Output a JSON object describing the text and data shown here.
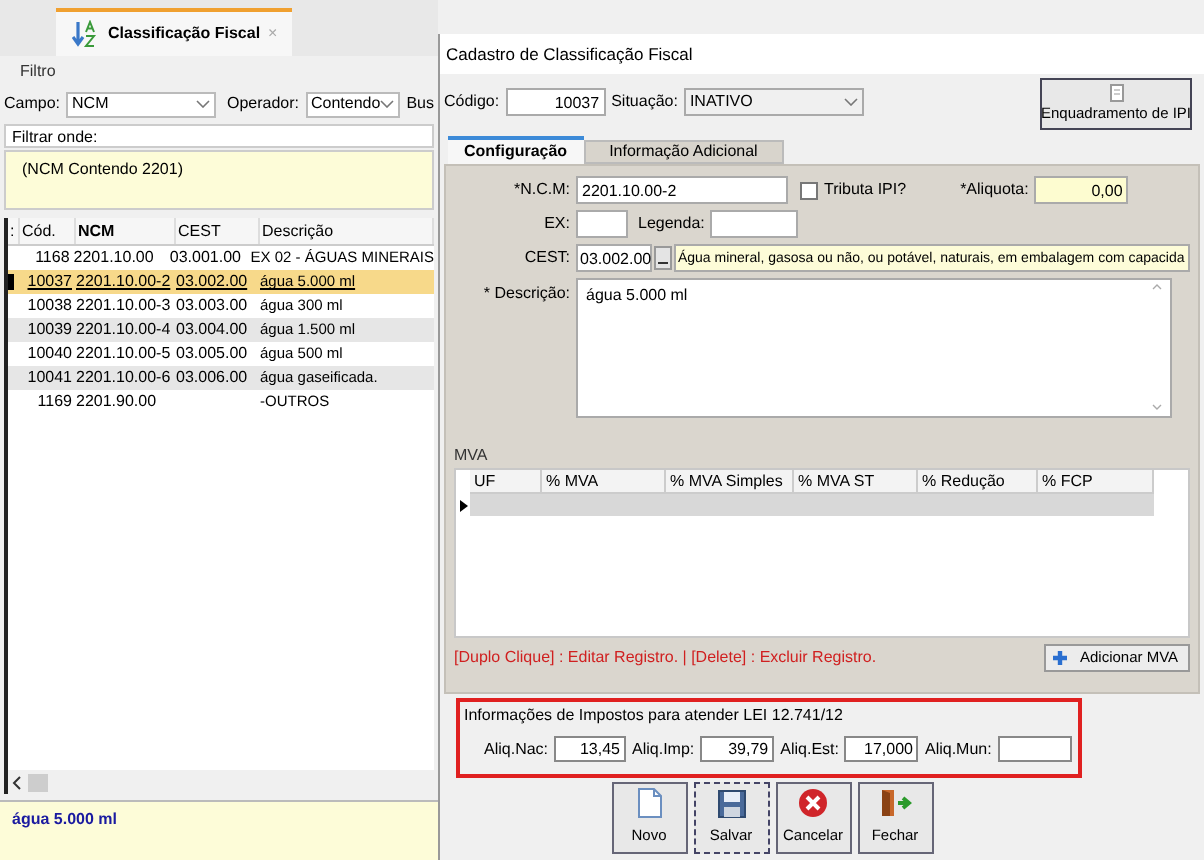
{
  "tab": {
    "title": "Classificação Fiscal",
    "close": "×"
  },
  "filter": {
    "title": "Filtro",
    "campo_label": "Campo:",
    "campo": "NCM",
    "operador_label": "Operador:",
    "operador": "Contendo",
    "busca_label": "Bus",
    "where_label": "Filtrar onde:",
    "expression": "(NCM Contendo 2201)"
  },
  "grid": {
    "columns": [
      ":",
      "Cód.",
      "NCM",
      "CEST",
      "Descrição"
    ],
    "rows": [
      {
        "cod": "1168",
        "ncm": "2201.10.00",
        "cest": "03.001.00",
        "descricao": "EX 02 - ÁGUAS MINERAIS",
        "selected": false
      },
      {
        "cod": "10037",
        "ncm": "2201.10.00-2",
        "cest": "03.002.00",
        "descricao": "água 5.000 ml",
        "selected": true
      },
      {
        "cod": "10038",
        "ncm": "2201.10.00-3",
        "cest": "03.003.00",
        "descricao": "água 300 ml",
        "selected": false
      },
      {
        "cod": "10039",
        "ncm": "2201.10.00-4",
        "cest": "03.004.00",
        "descricao": "água 1.500 ml",
        "selected": false
      },
      {
        "cod": "10040",
        "ncm": "2201.10.00-5",
        "cest": "03.005.00",
        "descricao": "água 500 ml",
        "selected": false
      },
      {
        "cod": "10041",
        "ncm": "2201.10.00-6",
        "cest": "03.006.00",
        "descricao": "água gaseificada.",
        "selected": false
      },
      {
        "cod": "1169",
        "ncm": "2201.90.00",
        "cest": "",
        "descricao": "-OUTROS",
        "selected": false
      }
    ]
  },
  "footer": "água 5.000 ml",
  "dialog": {
    "title": "Cadastro de Classificação Fiscal",
    "codigo_label": "Código:",
    "codigo": "10037",
    "situacao_label": "Situação:",
    "situacao": "INATIVO",
    "enquadramento_button": "Enquadramento de IPI",
    "tabs": [
      {
        "label": "Configuração",
        "selected": true
      },
      {
        "label": "Informação Adicional",
        "selected": false
      }
    ],
    "form": {
      "ncm_label": "*N.C.M:",
      "ncm": "2201.10.00-2",
      "tributa_ipi_label": "Tributa IPI?",
      "tributa_ipi": false,
      "aliquota_label": "*Aliquota:",
      "aliquota": "0,00",
      "ex_label": "EX:",
      "legenda_label": "Legenda:",
      "cest_label": "CEST:",
      "cest": "03.002.00",
      "cest_description": "Água mineral, gasosa ou não, ou potável, naturais, em embalagem com capacida",
      "descricao_label": "* Descrição:",
      "descricao": "água 5.000 ml"
    },
    "mva": {
      "title": "MVA",
      "columns": [
        "UF",
        "% MVA",
        "% MVA Simples",
        "% MVA ST",
        "% Redução",
        "% FCP"
      ]
    },
    "hint": "[Duplo Clique] : Editar Registro. | [Delete] : Excluir Registro.",
    "add_button": "Adicionar MVA",
    "impostos": {
      "title": "Informações de Impostos para atender LEI 12.741/12",
      "fields": [
        {
          "label": "Aliq.Nac:",
          "value": "13,45"
        },
        {
          "label": "Aliq.Imp:",
          "value": "39,79"
        },
        {
          "label": "Aliq.Est:",
          "value": "17,000"
        },
        {
          "label": "Aliq.Mun:"
        }
      ]
    },
    "actions": [
      {
        "label": "Novo",
        "kind": "new"
      },
      {
        "label": "Salvar",
        "kind": "save"
      },
      {
        "label": "Cancelar",
        "kind": "cancel"
      },
      {
        "label": "Fechar",
        "kind": "close"
      }
    ]
  }
}
